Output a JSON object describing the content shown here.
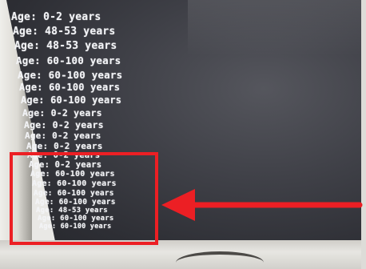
{
  "log_lines": [
    "Age: 0-2 years",
    "Age: 48-53 years",
    "Age: 48-53 years",
    "Age: 60-100 years",
    "Age: 60-100 years",
    "Age: 60-100 years",
    "Age: 60-100 years",
    "Age: 0-2 years",
    "Age: 0-2 years",
    "Age: 0-2 years",
    "Age: 0-2 years",
    "Age: 0-2 years",
    "Age: 0-2 years",
    "Age: 60-100 years",
    "Age: 60-100 years",
    "Age: 60-100 years",
    "Age: 60-100 years",
    "Age: 48-53 years",
    "Age: 60-100 years",
    "Age: 60-100 years"
  ],
  "colors": {
    "annotation": "#ec1f24",
    "text": "#f2f3f6",
    "screen": "#3f4047"
  }
}
